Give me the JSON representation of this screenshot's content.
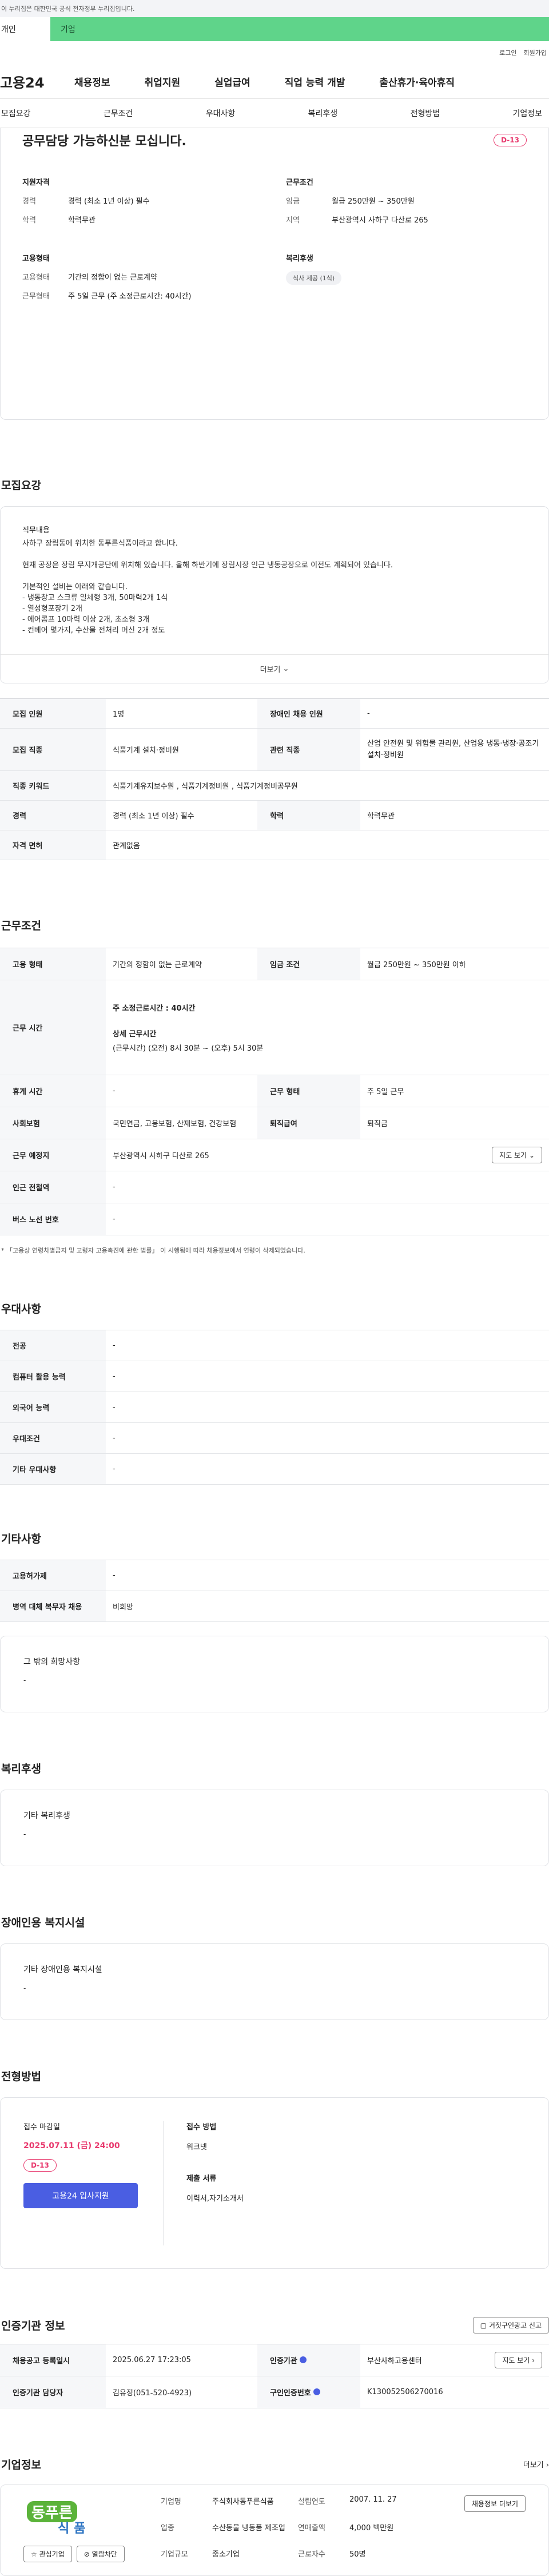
{
  "topbar": {
    "notice": "이 누리집은 대한민국 공식 전자정부 누리집입니다."
  },
  "tabs": {
    "left": "개인",
    "right": "기업"
  },
  "util": {
    "login": "로그인",
    "join": "회원가입"
  },
  "gnb": {
    "logo": "고용24",
    "items": [
      "채용정보",
      "취업지원",
      "실업급여",
      "직업 능력 개발",
      "출산휴가·육아휴직"
    ]
  },
  "subnav": [
    "모집요강",
    "근무조건",
    "우대사항",
    "복리후생",
    "전형방법",
    "기업정보"
  ],
  "hero": {
    "title": "공무담당 가능하신분 모십니다.",
    "dday": "D-13",
    "qual": {
      "heading": "지원자격",
      "rows": [
        {
          "k": "경력",
          "v": "경력 (최소 1년 이상) 필수"
        },
        {
          "k": "학력",
          "v": "학력무관"
        }
      ]
    },
    "cond": {
      "heading": "근무조건",
      "rows": [
        {
          "k": "임금",
          "v": "월급 250만원 ~ 350만원"
        },
        {
          "k": "지역",
          "v": "부산광역시 사하구 다산로 265"
        }
      ]
    },
    "emp": {
      "heading": "고용형태",
      "rows": [
        {
          "k": "고용형태",
          "v": "기간의 정함이 없는 근로계약"
        },
        {
          "k": "근무형태",
          "v": "주 5일 근무 (주 소정근로시간: 40시간)"
        }
      ]
    },
    "welfare": {
      "heading": "복리후생",
      "chip": "식사 제공 (1식)"
    }
  },
  "recruit": {
    "section_title": "모집요강",
    "desc_heading": "직무내용",
    "desc_lines": [
      "사하구 장림동에 위치한 동푸른식품이라고 합니다.",
      "",
      "현재 공장은 장림 무지개공단에 위치해 있습니다. 올해 하반기에 장림시장 인근 냉동공장으로 이전도 계획되어 있습니다.",
      "",
      "기본적인 설비는 아래와 같습니다.",
      "- 냉동창고 스크류 일체형 3개, 50마력2개 1식",
      "- 열성형포장기 2개",
      "- 에어콤프 10마력 이상 2개, 초소형 3개",
      "- 컨베어 몇가지, 수산물 전처리 머신 2개 정도"
    ],
    "more": "더보기",
    "table": [
      {
        "k1": "모집 인원",
        "v1": "1명",
        "k2": "장애인 채용 인원",
        "v2": "-"
      },
      {
        "k1": "모집 직종",
        "v1": "식품기계 설치·정비원",
        "k2": "관련 직종",
        "v2": "산업 안전원 및 위험물 관리원, 산업용 냉동·냉장·공조기 설치·정비원"
      },
      {
        "k1": "직종 키워드",
        "v1": "식품기계유지보수원 , 식품기계정비원 , 식품기계정비공무원"
      },
      {
        "k1": "경력",
        "v1": "경력 (최소 1년 이상) 필수",
        "k2": "학력",
        "v2": "학력무관"
      },
      {
        "k1": "자격 면허",
        "v1": "관계없음"
      }
    ]
  },
  "work": {
    "section_title": "근무조건",
    "emp_type_k": "고용 형태",
    "emp_type_v": "기간의 정함이 없는 근로계약",
    "wage_k": "임금 조건",
    "wage_v": "월급 250만원 ~ 350만원 이하",
    "hours_k": "근무 시간",
    "hours_main": "주 소정근로시간 : 40시간",
    "hours_detail_heading": "상세 근무시간",
    "hours_detail": "(근무시간) (오전) 8시 30분 ~ (오후) 5시 30분",
    "rest_k": "휴게 시간",
    "rest_v": "-",
    "form_k": "근무 형태",
    "form_v": "주 5일 근무",
    "ins_k": "사회보험",
    "ins_v": "국민연금, 고용보험, 산재보험, 건강보험",
    "retire_k": "퇴직급여",
    "retire_v": "퇴직금",
    "loc_k": "근무 예정지",
    "loc_v": "부산광역시 사하구 다산로 265",
    "map_btn": "지도 보기",
    "subway_k": "인근 전철역",
    "subway_v": "-",
    "bus_k": "버스 노선 번호",
    "bus_v": "-",
    "note": "* 「고용상 연령차별금지 및 고령자 고용촉진에 관한 법률」 이 시행됨에 따라 채용정보에서 연령이 삭제되었습니다."
  },
  "pref": {
    "section_title": "우대사항",
    "rows": [
      {
        "k": "전공",
        "v": "-"
      },
      {
        "k": "컴퓨터 활용 능력",
        "v": "-"
      },
      {
        "k": "외국어 능력",
        "v": "-"
      },
      {
        "k": "우대조건",
        "v": "-"
      },
      {
        "k": "기타 우대사항",
        "v": "-"
      }
    ]
  },
  "etc": {
    "section_title": "기타사항",
    "rows": [
      {
        "k": "고용허가제",
        "v": "-"
      },
      {
        "k": "병역 대체 복무자 채용",
        "v": "비희망"
      }
    ],
    "other_heading": "그 밖의 희망사항",
    "other_v": "-"
  },
  "welfare": {
    "section_title": "복리후생",
    "heading": "기타 복리후생",
    "v": "-"
  },
  "disabled": {
    "section_title": "장애인용 복지시설",
    "heading": "기타 장애인용 복지시설",
    "v": "-"
  },
  "apply": {
    "section_title": "전형방법",
    "deadline_k": "접수 마감일",
    "deadline_v": "2025.07.11 (금) 24:00",
    "dday": "D-13",
    "apply_btn": "고용24 입사지원",
    "method_k": "접수 방법",
    "method_v": "워크넷",
    "docs_k": "제출 서류",
    "docs_v": "이력서,자기소개서"
  },
  "auth": {
    "section_title": "인증기관 정보",
    "report_btn": "거짓구인광고 신고",
    "reg_k": "채용공고 등록일시",
    "reg_v": "2025.06.27 17:23:05",
    "org_k": "인증기관",
    "org_v": "부산사하고용센터",
    "map_btn": "지도 보기",
    "mgr_k": "인증기관 담당자",
    "mgr_v": "김유정(051-520-4923)",
    "id_k": "구인인증번호",
    "id_v": "K130052506270016"
  },
  "company": {
    "section_title": "기업정보",
    "more": "더보기",
    "logo_top": "동푸른",
    "logo_bottom": "식품",
    "fav_btn": "관심기업",
    "block_btn": "열람차단",
    "name_k": "기업명",
    "name_v": "주식회사동푸른식품",
    "founded_k": "설립연도",
    "founded_v": "2007. 11. 27",
    "sales_k": "연매출액",
    "sales_v": "4,000 백만원",
    "industry_k": "업종",
    "industry_v": "수산동물 냉동품 제조업",
    "staff_k": "근로자수",
    "staff_v": "50명",
    "size_k": "기업규모",
    "size_v": "중소기업",
    "jobs_btn": "채용정보 더보기"
  },
  "colors": {
    "accent": "#4a5ee2",
    "dday": "#e83a6e",
    "tab_green": "#5fd48a"
  }
}
